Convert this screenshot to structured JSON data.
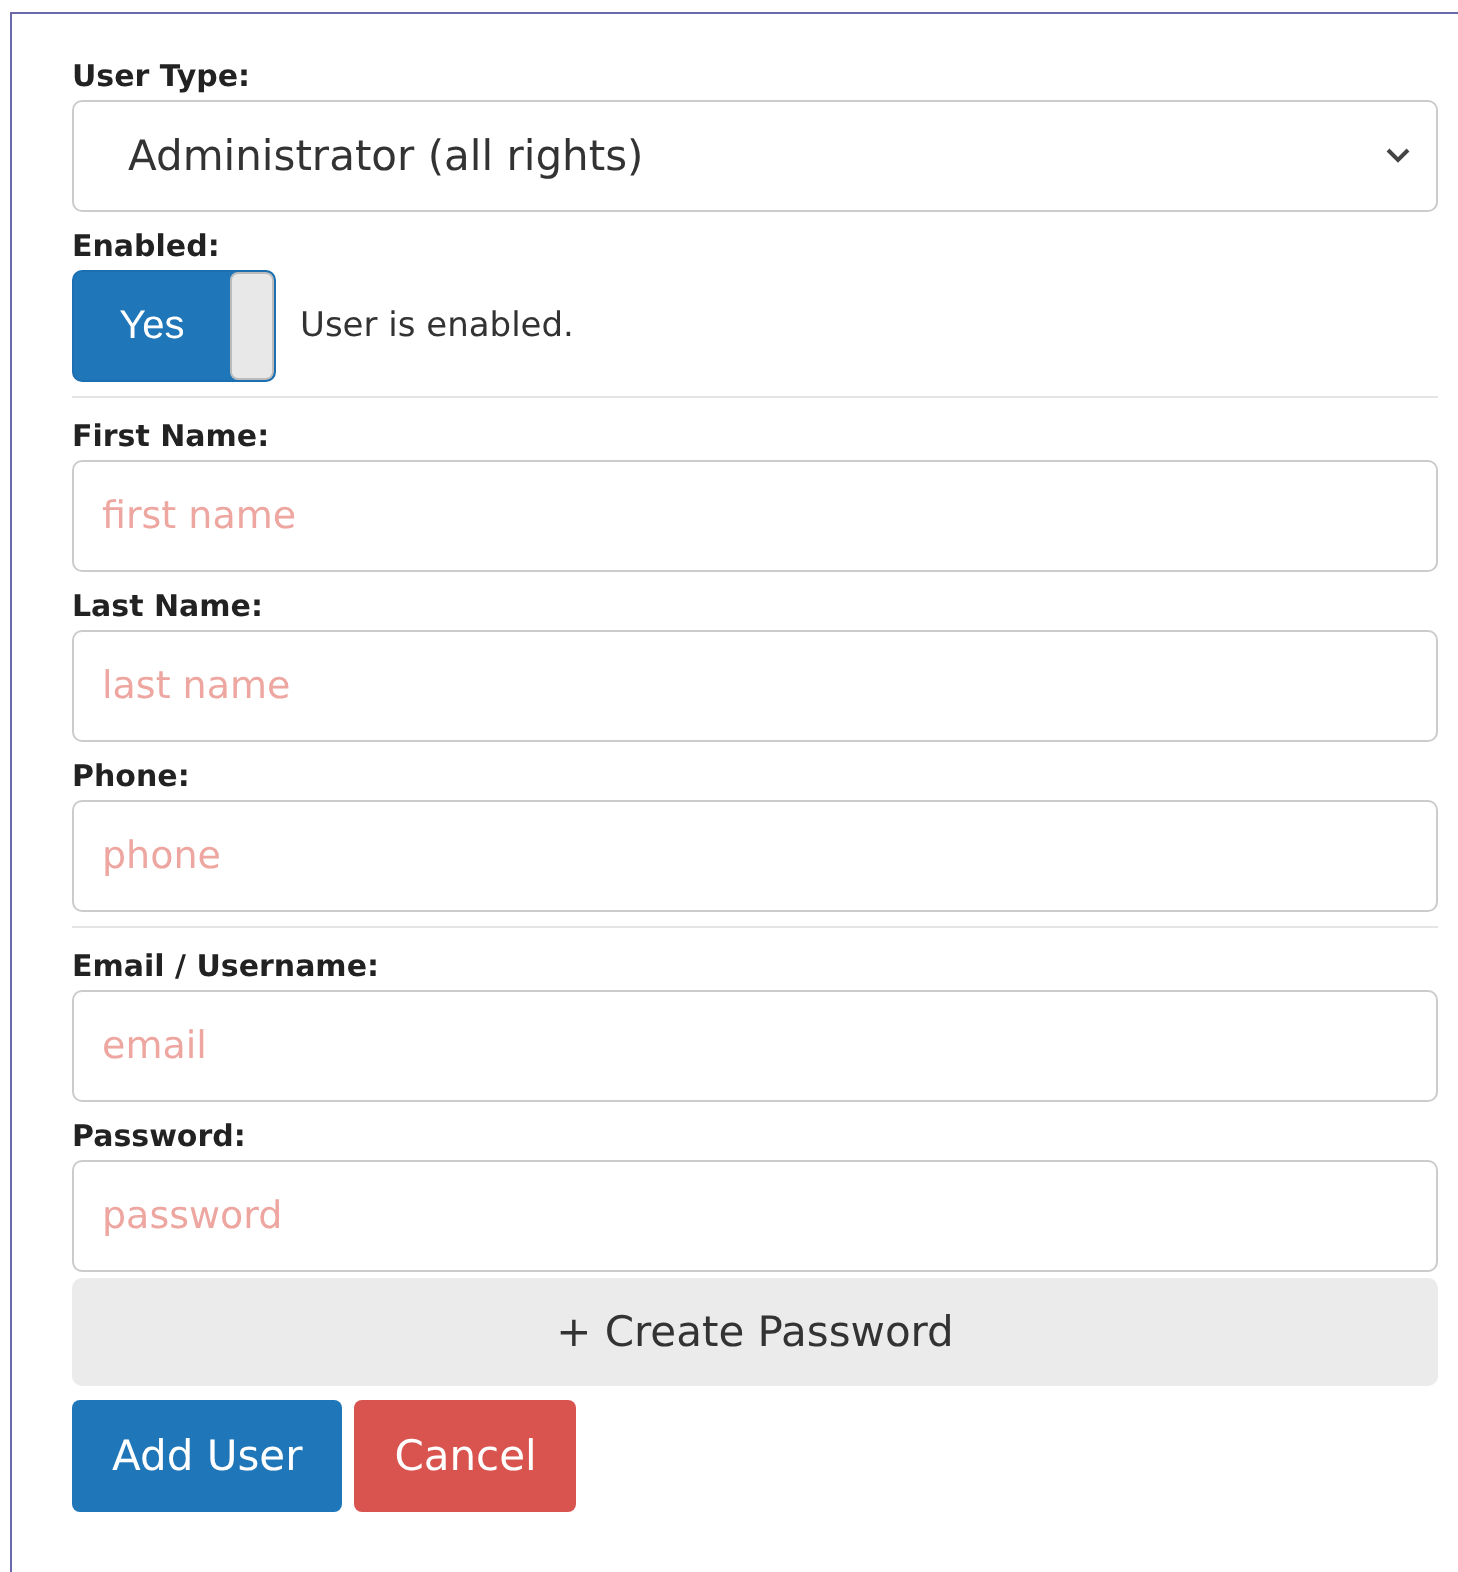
{
  "user_type": {
    "label": "User Type:",
    "value": "Administrator (all rights)"
  },
  "enabled": {
    "label": "Enabled:",
    "on": true,
    "toggle_text": "Yes",
    "note": "User is enabled."
  },
  "field_groups": [
    [
      {
        "label": "First Name:",
        "placeholder": "first name"
      },
      {
        "label": "Last Name:",
        "placeholder": "last name"
      },
      {
        "label": "Phone:",
        "placeholder": "phone"
      }
    ],
    [
      {
        "label": "Email / Username:",
        "placeholder": "email"
      },
      {
        "label": "Password:",
        "placeholder": "password"
      }
    ]
  ],
  "create_password_button": "+ Create Password",
  "buttons": [
    {
      "label": "Add User",
      "kind": "primary"
    },
    {
      "label": "Cancel",
      "kind": "danger"
    }
  ]
}
